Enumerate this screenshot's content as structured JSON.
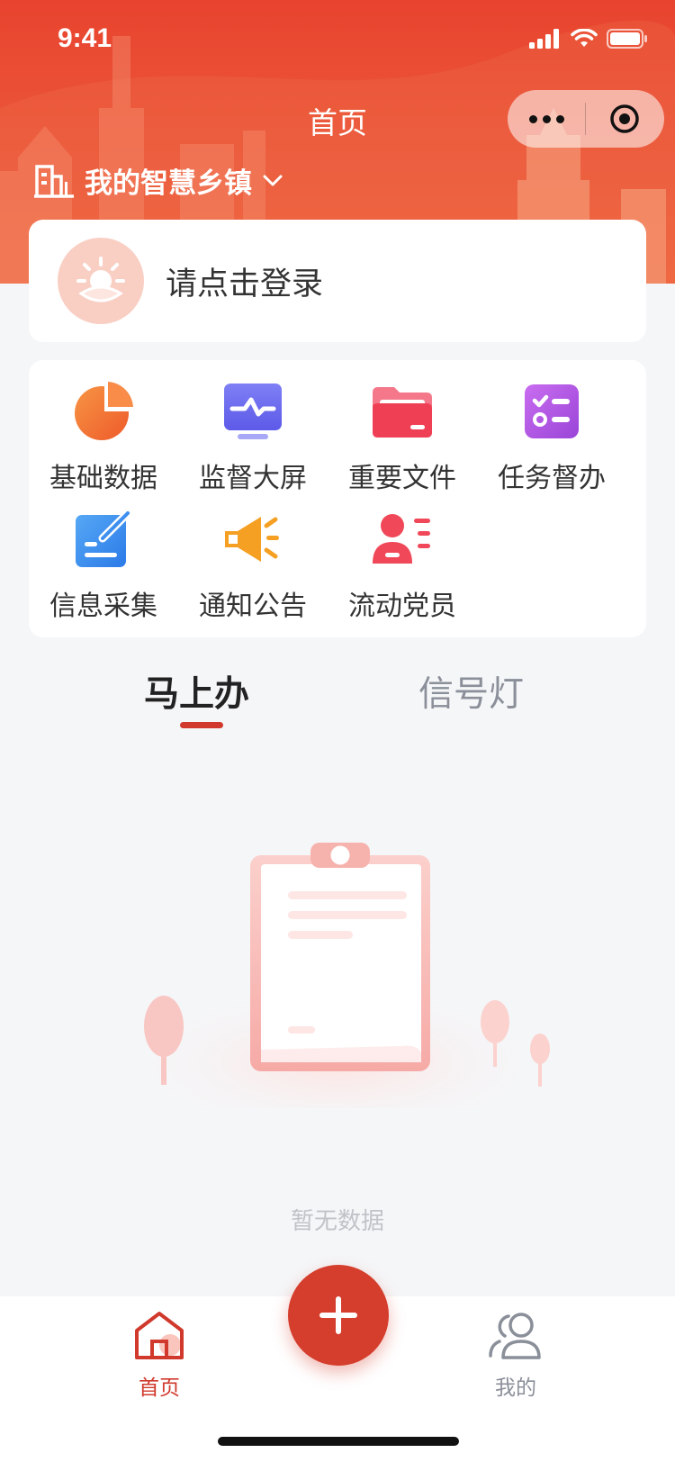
{
  "status_bar": {
    "time": "9:41"
  },
  "nav": {
    "title": "首页"
  },
  "town_selector": {
    "label": "我的智慧乡镇"
  },
  "login": {
    "prompt": "请点击登录"
  },
  "grid": {
    "items": [
      {
        "label": "基础数据",
        "icon": "pie-chart-icon",
        "color": "#f2683a"
      },
      {
        "label": "监督大屏",
        "icon": "monitor-screen-icon",
        "color": "#6f6ef0"
      },
      {
        "label": "重要文件",
        "icon": "folder-icon",
        "color": "#f0445a"
      },
      {
        "label": "任务督办",
        "icon": "task-checklist-icon",
        "color": "#b45ae6"
      },
      {
        "label": "信息采集",
        "icon": "edit-note-icon",
        "color": "#3e8ff0"
      },
      {
        "label": "通知公告",
        "icon": "megaphone-icon",
        "color": "#f5a023"
      },
      {
        "label": "流动党员",
        "icon": "person-list-icon",
        "color": "#f04858"
      }
    ]
  },
  "tabs": {
    "active": "马上办",
    "inactive": "信号灯"
  },
  "empty": {
    "text": "暂无数据"
  },
  "tabbar": {
    "home": "首页",
    "mine": "我的"
  },
  "colors": {
    "brand": "#d0392c",
    "header": "#e8432e"
  }
}
